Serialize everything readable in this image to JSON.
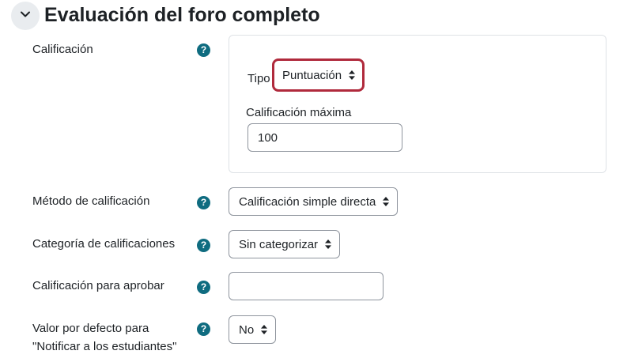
{
  "section": {
    "title": "Evaluación del foro completo",
    "collapse_icon": "chevron-down-icon"
  },
  "help_icon_glyph": "?",
  "grade": {
    "label": "Calificación",
    "type_label": "Tipo",
    "type_value": "Puntuación",
    "max_label": "Calificación máxima",
    "max_value": "100"
  },
  "method": {
    "label": "Método de calificación",
    "value": "Calificación simple directa"
  },
  "category": {
    "label": "Categoría de calificaciones",
    "value": "Sin categorizar"
  },
  "pass": {
    "label": "Calificación para aprobar",
    "value": ""
  },
  "notify": {
    "label_line1": "Valor por defecto para",
    "label_line2": "\"Notificar a los estudiantes\"",
    "value": "No"
  },
  "colors": {
    "help_icon": "#0f6c80",
    "highlight_border": "#b02a3c"
  }
}
